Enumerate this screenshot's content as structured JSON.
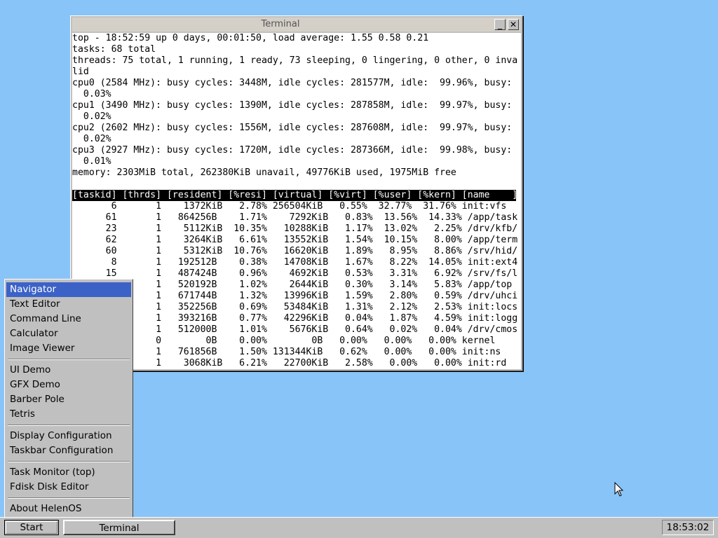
{
  "window": {
    "title": "Terminal",
    "minimize_glyph": "_",
    "close_glyph": "✕",
    "terminal_lines": [
      "top - 18:52:59 up 0 days, 00:01:50, load average: 1.55 0.58 0.21",
      "tasks: 68 total",
      "threads: 75 total, 1 running, 1 ready, 73 sleeping, 0 lingering, 0 other, 0 inva",
      "lid",
      "cpu0 (2584 MHz): busy cycles: 3448M, idle cycles: 281577M, idle:  99.96%, busy:",
      "  0.03%",
      "cpu1 (3490 MHz): busy cycles: 1390M, idle cycles: 287858M, idle:  99.97%, busy:",
      "  0.02%",
      "cpu2 (2602 MHz): busy cycles: 1556M, idle cycles: 287608M, idle:  99.97%, busy:",
      "  0.02%",
      "cpu3 (2927 MHz): busy cycles: 1720M, idle cycles: 287366M, idle:  99.98%, busy:",
      "  0.01%",
      "memory: 2303MiB total, 262380KiB unavail, 49776KiB used, 1975MiB free",
      ""
    ],
    "table_header": "[taskid] [thrds] [resident] [%resi] [virtual] [%virt] [%user] [%kern] [name    ]",
    "table_rows": [
      "       6       1    1372KiB   2.78% 256504KiB   0.55%  32.77%  31.76% init:vfs",
      "      61       1   864256B    1.71%    7292KiB   0.83%  13.56%  14.33% /app/task",
      "      23       1    5112KiB  10.35%   10288KiB   1.17%  13.02%   2.25% /drv/kfb/",
      "      62       1    3264KiB   6.61%   13552KiB   1.54%  10.15%   8.00% /app/term",
      "      60       1    5312KiB  10.76%   16620KiB   1.89%   8.95%   8.86% /srv/hid/",
      "       8       1   192512B    0.38%   14708KiB   1.67%   8.22%  14.05% init:ext4",
      "      15       1   487424B    0.96%    4692KiB   0.53%   3.31%   6.92% /srv/fs/l",
      "               1   520192B    1.02%    2644KiB   0.30%   3.14%   5.83% /app/top",
      "               1   671744B    1.32%   13996KiB   1.59%   2.80%   0.59% /drv/uhci",
      "               1   352256B    0.69%   53484KiB   1.31%   2.12%   2.53% init:locs",
      "               1   393216B    0.77%   42296KiB   0.04%   1.87%   4.59% init:logg",
      "               1   512000B    1.01%    5676KiB   0.64%   0.02%   0.04% /drv/cmos",
      "               0        0B    0.00%        0B   0.00%   0.00%   0.00% kernel",
      "               1   761856B    1.50% 131344KiB   0.62%   0.00%   0.00% init:ns",
      "               1    3068KiB   6.21%   22700KiB   2.58%   0.00%   0.00% init:rd"
    ]
  },
  "start_menu": {
    "groups": [
      [
        "Navigator",
        "Text Editor",
        "Command Line",
        "Calculator",
        "Image Viewer"
      ],
      [
        "UI Demo",
        "GFX Demo",
        "Barber Pole",
        "Tetris"
      ],
      [
        "Display Configuration",
        "Taskbar Configuration"
      ],
      [
        "Task Monitor (top)",
        "Fdisk Disk Editor"
      ],
      [
        "About HelenOS"
      ]
    ],
    "selected": "Navigator"
  },
  "taskbar": {
    "start_label": "Start",
    "window_buttons": [
      "Terminal"
    ],
    "clock": "18:53:02"
  },
  "colors": {
    "desktop": "#88c4f8",
    "menu_highlight": "#3c62c8"
  }
}
